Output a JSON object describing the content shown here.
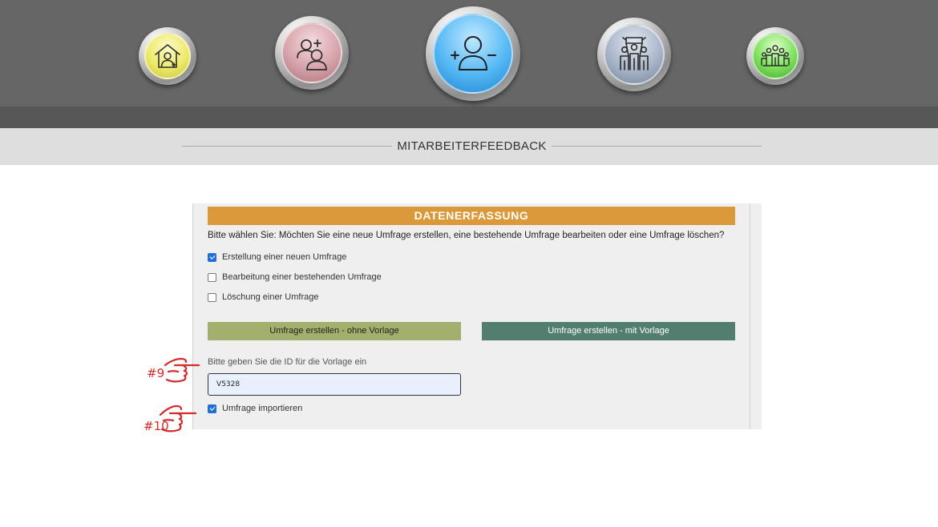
{
  "nav": {
    "items": [
      {
        "id": "home",
        "icon": "house-user-icon",
        "color": "#eeea6c"
      },
      {
        "id": "add-users",
        "icon": "users-plus-icon",
        "color": "#d7a3aa"
      },
      {
        "id": "employee-feedback",
        "icon": "user-plus-minus-icon",
        "color": "#54b8f4",
        "active": true
      },
      {
        "id": "team",
        "icon": "team-banner-icon",
        "color": "#a8b5c8"
      },
      {
        "id": "group",
        "icon": "group-icon",
        "color": "#7ee05c"
      }
    ]
  },
  "page": {
    "title": "MITARBEITERFEEDBACK"
  },
  "form": {
    "section_title": "DATENERFASSUNG",
    "section_color": "#db9939",
    "question": "Bitte wählen Sie: Möchten Sie eine neue Umfrage erstellen, eine bestehende Umfrage bearbeiten oder eine Umfrage löschen?",
    "options": [
      {
        "label": "Erstellung einer neuen Umfrage",
        "checked": true
      },
      {
        "label": "Bearbeitung einer bestehenden Umfrage",
        "checked": false
      },
      {
        "label": "Löschung einer Umfrage",
        "checked": false
      }
    ],
    "buttons": {
      "no_template": "Umfrage erstellen - ohne Vorlage",
      "with_template": "Umfrage erstellen - mit Vorlage"
    },
    "template_id_label": "Bitte geben Sie die ID für die Vorlage ein",
    "template_id_value": "V5328",
    "import": {
      "label": "Umfrage importieren",
      "checked": true
    }
  },
  "annotations": {
    "step9": "#9",
    "step10": "#10",
    "color": "#d42a2a"
  }
}
